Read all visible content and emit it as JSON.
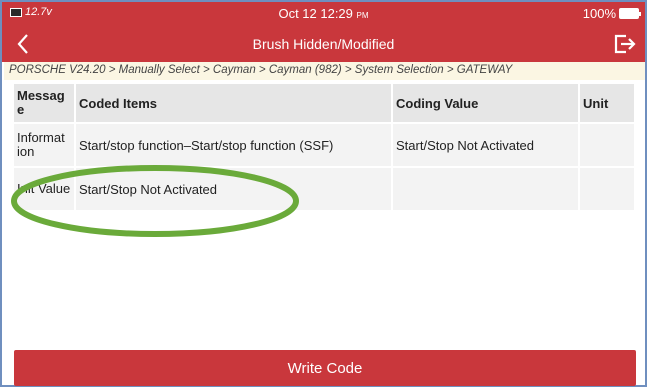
{
  "status_bar": {
    "left_text": "12.7v",
    "time": "Oct 12  12:29",
    "ampm": "PM",
    "battery": "100%"
  },
  "title_bar": {
    "title": "Brush Hidden/Modified",
    "back_icon": "chevron-left-icon",
    "exit_icon": "exit-icon"
  },
  "breadcrumb": "PORSCHE V24.20 > Manually Select > Cayman > Cayman (982) > System Selection > GATEWAY",
  "table": {
    "headers": [
      "Messag e",
      "Coded Items",
      "Coding Value",
      "Unit"
    ],
    "rows": [
      [
        "Informat ion",
        "Start/stop function–Start/stop function (SSF)",
        "Start/Stop Not Activated",
        ""
      ],
      [
        "Init Value",
        "Start/Stop Not Activated",
        "",
        ""
      ]
    ]
  },
  "buttons": {
    "write_code": "Write Code"
  },
  "colors": {
    "accent": "#c9373c",
    "breadcrumb_bg": "#fbf6e3",
    "highlight": "#6aaa3a"
  }
}
